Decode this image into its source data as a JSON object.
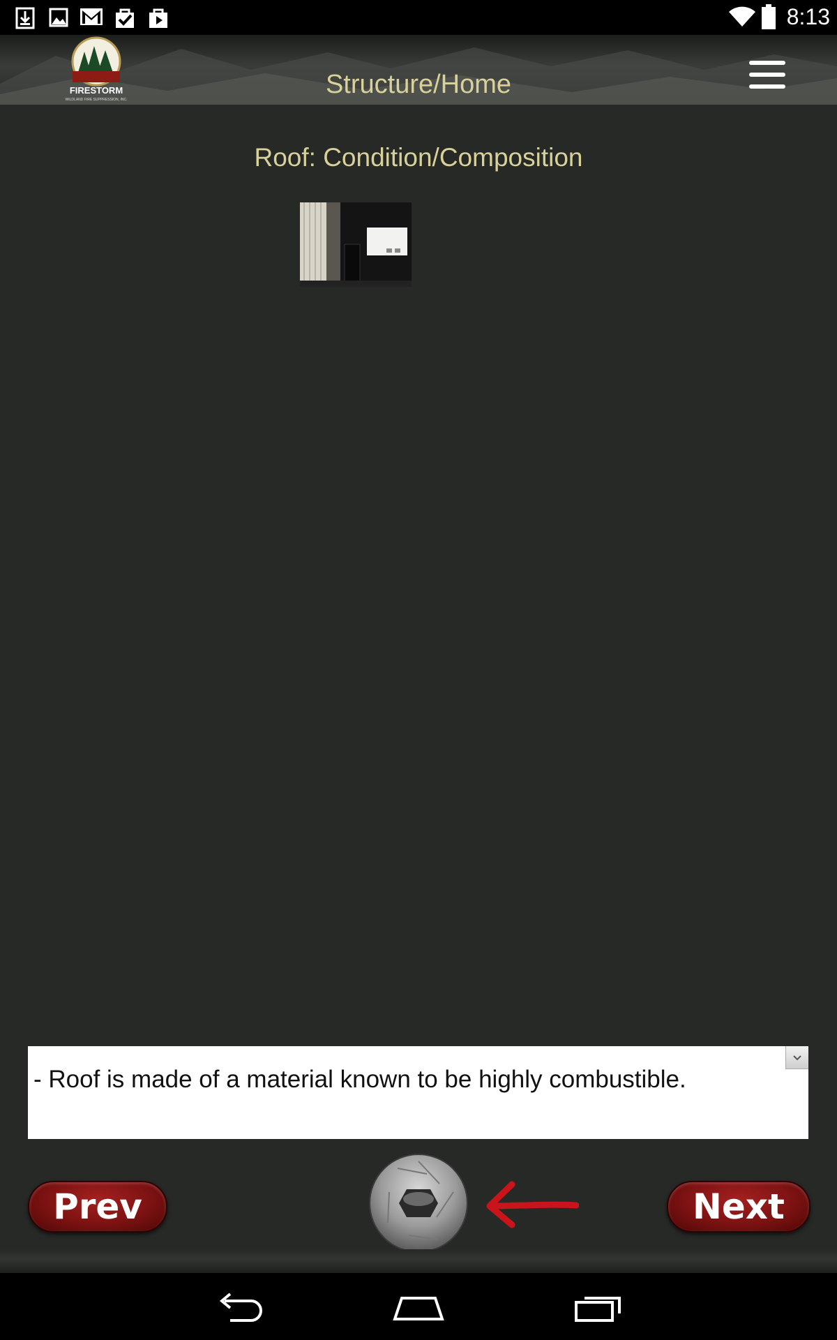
{
  "status_bar": {
    "time": "8:13",
    "left_icons": [
      "download-icon",
      "image-icon",
      "gmail-icon",
      "task-check-icon",
      "play-store-icon"
    ],
    "right_icons": [
      "wifi-icon",
      "battery-icon"
    ]
  },
  "header": {
    "title": "Structure/Home",
    "logo_text": "FIRESTORM",
    "logo_subtext": "WILDLAND FIRE SUPPRESSION, INC.",
    "menu_icon": "hamburger-menu-icon"
  },
  "page": {
    "section_title": "Roof: Condition/Composition",
    "photo_thumbnail": "photo-thumbnail"
  },
  "comments": {
    "value": "- Roof is made of a material known to be highly combustible."
  },
  "buttons": {
    "prev_label": "Prev",
    "next_label": "Next",
    "camera_icon": "camera-shutter-icon"
  },
  "annotation": {
    "arrow": "red-arrow-icon",
    "color": "#c8141a"
  },
  "nav_bar": {
    "icons": [
      "back-icon",
      "home-icon",
      "recents-icon"
    ]
  },
  "colors": {
    "background": "#272927",
    "title_text": "#d9d19a",
    "button_red": "#7d1212"
  }
}
